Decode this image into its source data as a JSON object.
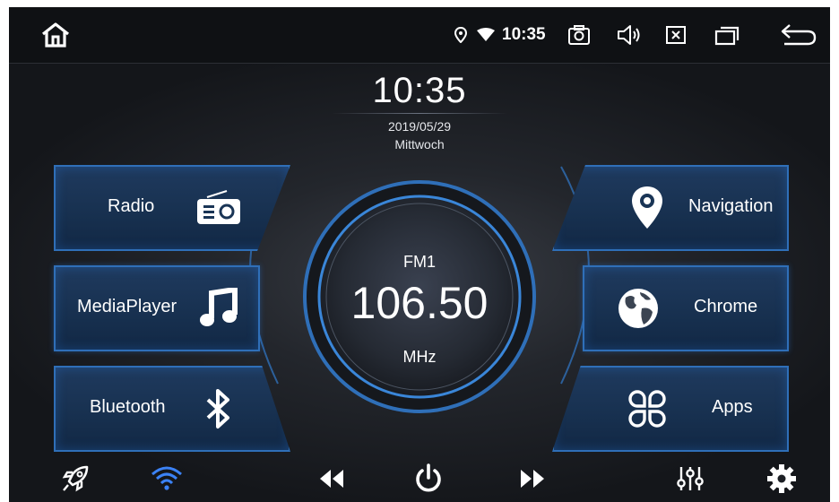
{
  "status_bar": {
    "time": "10:35",
    "icons": [
      "home-icon",
      "location-icon",
      "wifi-signal-icon",
      "screenshot-icon",
      "volume-icon",
      "close-app-icon",
      "recent-apps-icon",
      "back-icon"
    ]
  },
  "clock": {
    "time": "10:35",
    "date": "2019/05/29",
    "weekday": "Mittwoch"
  },
  "tiles": {
    "radio": "Radio",
    "mediaplayer": "MediaPlayer",
    "bluetooth": "Bluetooth",
    "navigation": "Navigation",
    "chrome": "Chrome",
    "apps": "Apps"
  },
  "tuner": {
    "band": "FM1",
    "frequency": "106.50",
    "unit": "MHz"
  },
  "bottom_bar": {
    "icons": [
      "rocket-icon",
      "wifi-icon",
      "rewind-icon",
      "power-icon",
      "fast-forward-icon",
      "equalizer-icon",
      "settings-icon"
    ]
  },
  "colors": {
    "accent": "#2f6fb8",
    "tile_bg": "#1a3556",
    "wifi_active": "#3b82f6",
    "background": "#1c1f24"
  }
}
